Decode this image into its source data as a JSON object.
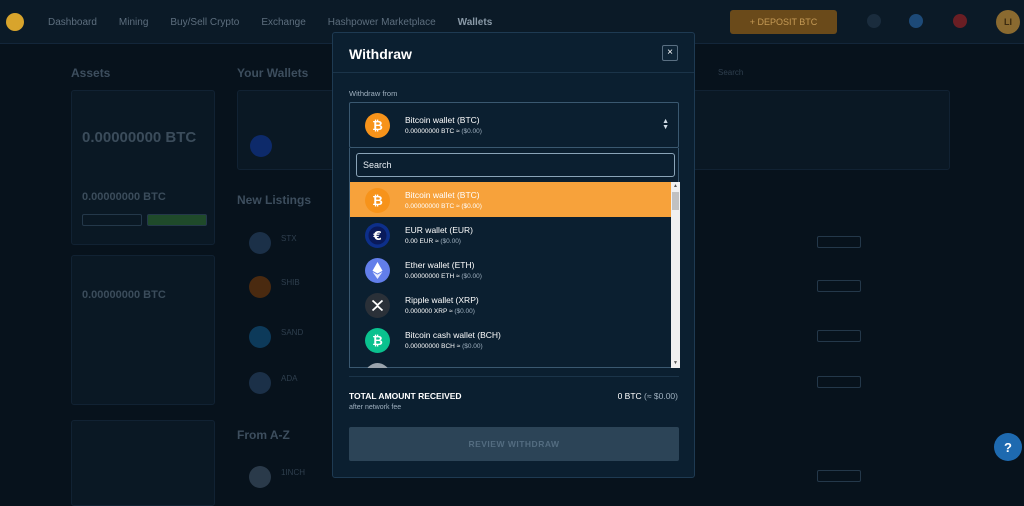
{
  "background": {
    "nav": [
      "Dashboard",
      "Mining",
      "Buy/Sell Crypto",
      "Exchange",
      "Hashpower Marketplace",
      "Wallets"
    ],
    "deposit_button": "+ DEPOSIT BTC",
    "avatar_initials": "LI",
    "assets_heading": "Assets",
    "wallets_heading": "Your Wallets",
    "new_listings_heading": "New Listings",
    "from_az_heading": "From A-Z",
    "total_balance_value": "0.00000000 BTC",
    "available_value": "0.00000000 BTC",
    "pending_value": "0.00000000 BTC",
    "search_placeholder": "Search",
    "listings": [
      {
        "symbol": "STX"
      },
      {
        "symbol": "SHIB"
      },
      {
        "symbol": "SAND"
      },
      {
        "symbol": "ADA"
      },
      {
        "symbol": "1INCH"
      }
    ]
  },
  "modal": {
    "title": "Withdraw",
    "close_label": "×",
    "withdraw_from_label": "Withdraw from",
    "selected": {
      "name": "Bitcoin wallet (BTC)",
      "amount": "0.00000000 BTC ≈",
      "fiat": "($0.00)",
      "icon": "bitcoin-icon"
    },
    "search_placeholder": "Search",
    "wallets": [
      {
        "name": "Bitcoin wallet (BTC)",
        "amount": "0.00000000 BTC ≈",
        "fiat": "($0.00)",
        "icon": "bitcoin-icon",
        "color": "#f7931a",
        "selected": true
      },
      {
        "name": "EUR wallet (EUR)",
        "amount": "0.00 EUR ≈",
        "fiat": "($0.00)",
        "icon": "euro-icon",
        "color": "#0d3aa8",
        "selected": false
      },
      {
        "name": "Ether wallet (ETH)",
        "amount": "0.00000000 ETH ≈",
        "fiat": "($0.00)",
        "icon": "ethereum-icon",
        "color": "#627eea",
        "selected": false
      },
      {
        "name": "Ripple wallet (XRP)",
        "amount": "0.000000 XRP ≈",
        "fiat": "($0.00)",
        "icon": "ripple-icon",
        "color": "#23292f",
        "selected": false
      },
      {
        "name": "Bitcoin cash wallet (BCH)",
        "amount": "0.00000000 BCH ≈",
        "fiat": "($0.00)",
        "icon": "bitcoin-cash-icon",
        "color": "#0ac18e",
        "selected": false
      }
    ],
    "total_label": "TOTAL AMOUNT RECEIVED",
    "total_sub": "after network fee",
    "total_value": "0 BTC",
    "total_fiat": "(≈ $0.00)",
    "review_button": "REVIEW WITHDRAW"
  },
  "help_label": "?",
  "colors": {
    "selected_row": "#f7a23b",
    "modal_bg": "#0b1f30",
    "help": "#1e6ab0"
  }
}
